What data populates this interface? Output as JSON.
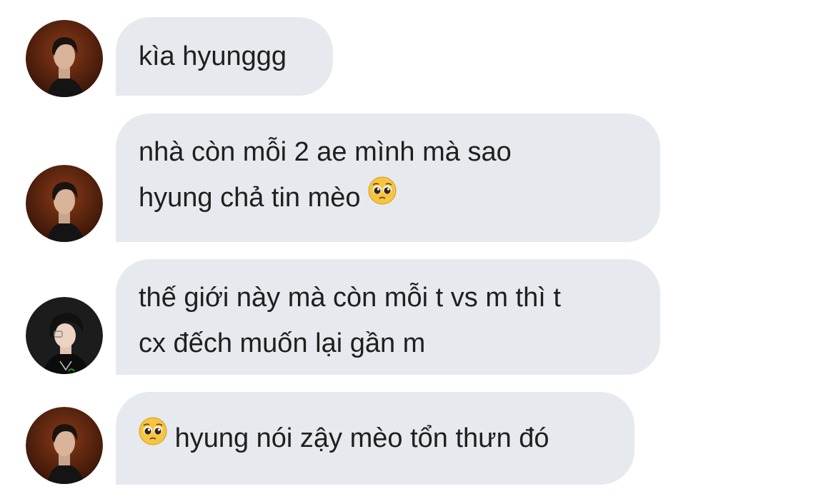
{
  "messages": [
    {
      "sender": "a",
      "lines": [
        "kìa hyunggg"
      ],
      "emoji": ""
    },
    {
      "sender": "a",
      "lines": [
        "nhà còn mỗi 2 ae mình mà sao",
        "hyung chả tin mèo"
      ],
      "emoji": "pleading-face"
    },
    {
      "sender": "b",
      "lines": [
        "thế giới này mà còn mỗi t vs m thì t",
        "cx đếch muốn lại gần m"
      ],
      "emoji": ""
    },
    {
      "sender": "a",
      "lines": [
        "hyung nói zậy mèo tổn thưn đó"
      ],
      "emoji": "pleading-face"
    }
  ],
  "colors": {
    "bubble": "#e6eaee",
    "text": "#1f1f1f",
    "avatar_a_bg": "#6b2a12",
    "avatar_b_bg": "#1c1c1c"
  }
}
